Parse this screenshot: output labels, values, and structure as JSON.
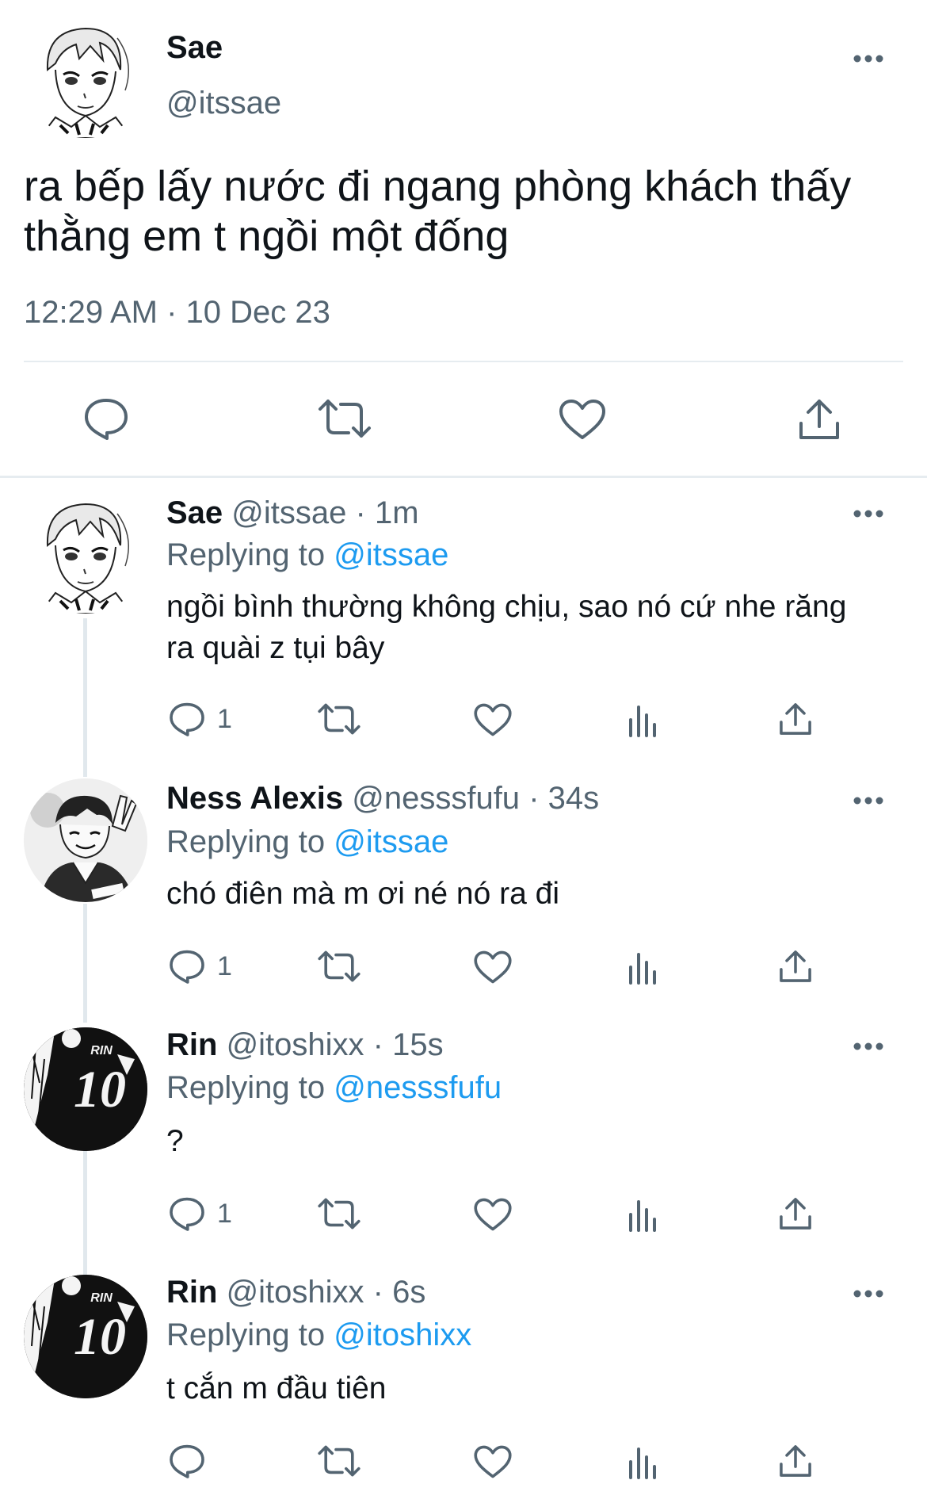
{
  "main_tweet": {
    "display_name": "Sae",
    "handle": "@itssae",
    "text": "ra bếp lấy nước đi ngang phòng khách thấy thằng em t ngồi một đống",
    "timestamp": "12:29 AM · 10 Dec 23"
  },
  "replies": [
    {
      "display_name": "Sae",
      "handle": "@itssae",
      "time": "· 1m",
      "replying_label": "Replying to",
      "replying_to": "@itssae",
      "text": "ngồi bình thường không chịu, sao nó cứ nhe răng ra quài z tụi bây",
      "reply_count": "1"
    },
    {
      "display_name": "Ness Alexis",
      "handle": "@nesssfufu",
      "time": "· 34s",
      "replying_label": "Replying to",
      "replying_to": "@itssae",
      "text": "chó điên mà m ơi né nó ra đi",
      "reply_count": "1"
    },
    {
      "display_name": "Rin",
      "handle": "@itoshixx",
      "time": "· 15s",
      "replying_label": "Replying to",
      "replying_to": "@nesssfufu",
      "text": "?",
      "reply_count": "1"
    },
    {
      "display_name": "Rin",
      "handle": "@itoshixx",
      "time": "· 6s",
      "replying_label": "Replying to",
      "replying_to": "@itoshixx",
      "text": "t cắn m đầu tiên",
      "reply_count": ""
    }
  ],
  "avatar_text": {
    "rin_name": "RIN",
    "rin_number": "10"
  },
  "colors": {
    "link": "#1d9bf0",
    "muted": "#536471",
    "icon": "#536471",
    "divider": "#e6ecf0"
  },
  "icons": [
    "more-icon",
    "reply-icon",
    "retweet-icon",
    "like-icon",
    "views-icon",
    "share-icon"
  ]
}
